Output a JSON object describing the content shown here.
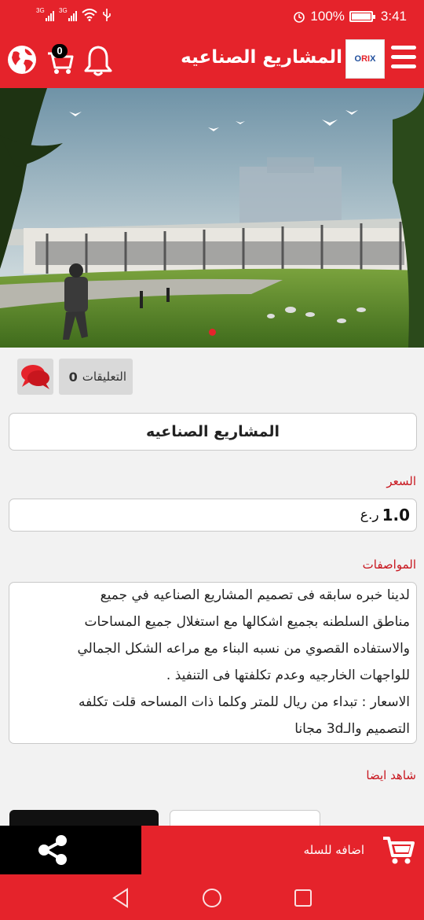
{
  "status_bar": {
    "net1": "3G",
    "net2": "3G",
    "battery_pct": "100%",
    "time": "3:41"
  },
  "app_bar": {
    "title": "المشاريع الصناعيه",
    "cart_count": "0",
    "logo_text_a": "O",
    "logo_text_b": "RI",
    "logo_text_c": "X"
  },
  "gallery": {
    "page_count": 1,
    "active_index": 0
  },
  "comments": {
    "count": "0",
    "label": "التعليقات"
  },
  "product": {
    "title": "المشاريع الصناعيه",
    "price_label": "السعر",
    "price_value": "1.0",
    "price_currency": "ر.ع",
    "specs_label": "المواصفات",
    "specs_lines": [
      "لدينا خبره سابقه فى تصميم المشاريع الصناعيه في جميع",
      "مناطق السلطنه بجميع اشكالها مع استغلال جميع المساحات",
      "والاستفاده القصوي من نسبه البناء مع مراعه الشكل الجمالي",
      "للواجهات الخارجيه وعدم تكلفتها فى التنفيذ .",
      "الاسعار : تبداء من ريال للمتر وكلما ذات المساحه قلت تكلفه",
      "التصميم والـ3d مجانا"
    ]
  },
  "see_also": {
    "label": "شاهد ايضا"
  },
  "bottom_bar": {
    "add_to_cart": "اضافه للسله"
  },
  "colors": {
    "brand": "#e5232b",
    "label_red": "#c8161e"
  },
  "icons": [
    "globe-icon",
    "cart-icon",
    "bell-icon",
    "menu-icon",
    "comment-icon",
    "share-icon",
    "cart-add-icon",
    "back-icon",
    "home-icon",
    "recents-icon"
  ]
}
